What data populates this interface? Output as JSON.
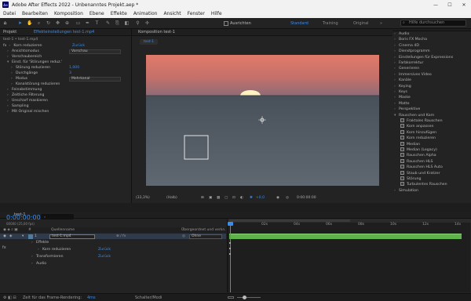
{
  "app": {
    "title": "Adobe After Effects 2022 - Unbenanntes Projekt.aep *",
    "icon": "Ae",
    "min": "—",
    "max": "☐",
    "close": "✕"
  },
  "menu": [
    "Datei",
    "Bearbeiten",
    "Komposition",
    "Ebene",
    "Effekte",
    "Animation",
    "Ansicht",
    "Fenster",
    "Hilfe"
  ],
  "toolbar": {
    "ausrichten": "Ausrichten",
    "workspaces": [
      "Standard",
      "Training",
      "Original"
    ],
    "search_placeholder": "Hilfe durchsuchen",
    "more": "»"
  },
  "left_panel": {
    "tab_project": "Projekt",
    "tab_effects": "Effekteinstellungen test-1.mp4",
    "breadcrumb": "test-1 • test-1.mp4",
    "rows": [
      {
        "label": "Korn reduzieren",
        "value": "Zurück",
        "indent": 0,
        "fx": true
      },
      {
        "label": "Ansichtsmodus",
        "value": "Vorschau",
        "indent": 1,
        "dropdown": true
      },
      {
        "label": "Vorschaubereich",
        "value": "",
        "indent": 1
      },
      {
        "label": "Einst. für 'Störungen reduz.'",
        "value": "",
        "indent": 1,
        "open": true
      },
      {
        "label": "Störung reduzieren",
        "value": "1,000",
        "indent": 2
      },
      {
        "label": "Durchgänge",
        "value": "3",
        "indent": 2
      },
      {
        "label": "Modus",
        "value": "Mehrkanal",
        "indent": 2,
        "dropdown": true
      },
      {
        "label": "Kanalstörung reduzieren",
        "value": "",
        "indent": 2
      },
      {
        "label": "Feinabstimmung",
        "value": "",
        "indent": 1
      },
      {
        "label": "Zeitliche Filterung",
        "value": "",
        "indent": 1
      },
      {
        "label": "Unscharf maskieren",
        "value": "",
        "indent": 1
      },
      {
        "label": "Sampling",
        "value": "",
        "indent": 1
      },
      {
        "label": "Mit Original mischen",
        "value": "",
        "indent": 1
      }
    ]
  },
  "comp": {
    "tab": "Komposition test-1",
    "subtab": "test-1",
    "zoom": "(33,3%)",
    "quality": "(Halb)",
    "time": "0:00:00:00",
    "exposure": "+0,0"
  },
  "effects_panel": {
    "items": [
      {
        "label": "Audio",
        "type": "cat"
      },
      {
        "label": "Boris FX Mocha",
        "type": "cat"
      },
      {
        "label": "Cinema 4D",
        "type": "cat"
      },
      {
        "label": "Dienstprogramm",
        "type": "cat"
      },
      {
        "label": "Einstellungen für Expressions",
        "type": "cat"
      },
      {
        "label": "Farbkorrektur",
        "type": "cat"
      },
      {
        "label": "Generieren",
        "type": "cat"
      },
      {
        "label": "Immersives Video",
        "type": "cat"
      },
      {
        "label": "Kanäle",
        "type": "cat"
      },
      {
        "label": "Keying",
        "type": "cat"
      },
      {
        "label": "Keys",
        "type": "cat"
      },
      {
        "label": "Maske",
        "type": "cat"
      },
      {
        "label": "Matte",
        "type": "cat"
      },
      {
        "label": "Perspektive",
        "type": "cat"
      },
      {
        "label": "Rauschen und Korn",
        "type": "open"
      },
      {
        "label": "Fraktales Rauschen",
        "type": "fx"
      },
      {
        "label": "Korn anpassen",
        "type": "fx"
      },
      {
        "label": "Korn hinzufügen",
        "type": "fx"
      },
      {
        "label": "Korn reduzieren",
        "type": "fx"
      },
      {
        "label": "Median",
        "type": "fx"
      },
      {
        "label": "Median (Legacy)",
        "type": "fx"
      },
      {
        "label": "Rauschen Alpha",
        "type": "fx"
      },
      {
        "label": "Rauschen HLS",
        "type": "fx"
      },
      {
        "label": "Rauschen HLS Auto",
        "type": "fx"
      },
      {
        "label": "Staub und Kratzer",
        "type": "fx"
      },
      {
        "label": "Störung",
        "type": "fx"
      },
      {
        "label": "Turbulentes Rauschen",
        "type": "fx"
      },
      {
        "label": "Simulation",
        "type": "cat"
      }
    ]
  },
  "timeline": {
    "tab": "test-1",
    "timecode": "0:00:00:00",
    "frame_info": "00000 (25,00 fps)",
    "col_source": "Quellenname",
    "col_parent": "Übergeordnet und verkn.",
    "layer_num": "1",
    "layer_name": "test-1.mp4",
    "layer_parent": "Ohne",
    "sub": [
      {
        "label": "Effekte",
        "value": ""
      },
      {
        "label": "Korn reduzieren",
        "value": "Zurück"
      },
      {
        "label": "Transformieren",
        "value": "Zurück"
      },
      {
        "label": "Audio",
        "value": ""
      }
    ],
    "ruler": [
      "0s",
      "02s",
      "04s",
      "06s",
      "08s",
      "10s",
      "12s",
      "14s"
    ]
  },
  "status": {
    "render_label": "Zeit für das Frame-Rendering:",
    "render_value": "4ms",
    "mode": "Schalter/Modi"
  },
  "colors": {
    "accent": "#3d8ce8",
    "layer_bar": "#5fb34a"
  }
}
